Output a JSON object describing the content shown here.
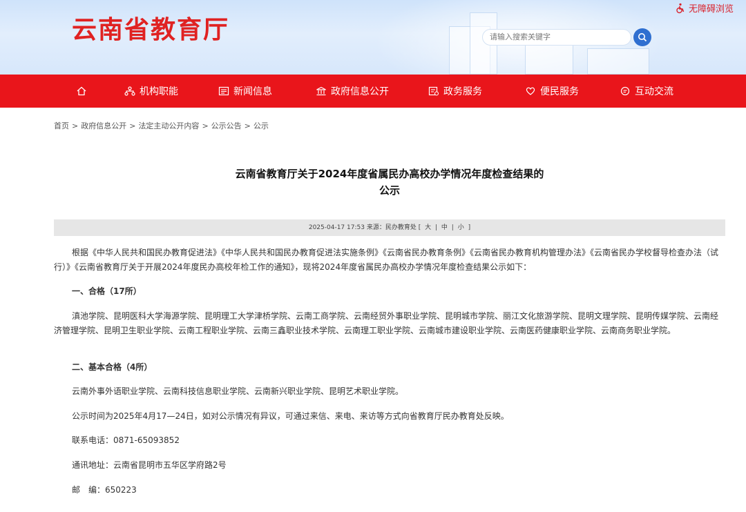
{
  "header": {
    "site_title": "云南省教育厅",
    "accessibility_link": "无障碍浏览",
    "search_placeholder": "请输入搜索关键字"
  },
  "nav": {
    "items": [
      {
        "label": "",
        "icon": "home-icon"
      },
      {
        "label": "机构职能",
        "icon": "org-icon"
      },
      {
        "label": "新闻信息",
        "icon": "news-icon"
      },
      {
        "label": "政府信息公开",
        "icon": "government-icon"
      },
      {
        "label": "政务服务",
        "icon": "service-icon"
      },
      {
        "label": "便民服务",
        "icon": "heart-hand-icon"
      },
      {
        "label": "互动交流",
        "icon": "chat-icon"
      }
    ]
  },
  "breadcrumb": [
    "首页",
    "政府信息公开",
    "法定主动公开内容",
    "公示公告",
    "公示"
  ],
  "article": {
    "title_line1": "云南省教育厅关于2024年度省属民办高校办学情况年度检查结果的",
    "title_line2": "公示",
    "meta": "2025-04-17 17:53 来源：民办教育处",
    "font_sizes": [
      "大",
      "中",
      "小"
    ],
    "paragraphs": {
      "intro": "根据《中华人民共和国民办教育促进法》《中华人民共和国民办教育促进法实施条例》《云南省民办教育条例》《云南省民办教育机构管理办法》《云南省民办学校督导检查办法（试行）》《云南省教育厅关于开展2024年度民办高校年检工作的通知》，现将2024年度省属民办高校办学情况年度检查结果公示如下：",
      "section1_heading": "一、合格（17所）",
      "section1_list": "滇池学院、昆明医科大学海源学院、昆明理工大学津桥学院、云南工商学院、云南经贸外事职业学院、昆明城市学院、丽江文化旅游学院、昆明文理学院、昆明传媒学院、云南经济管理学院、昆明卫生职业学院、云南工程职业学院、云南三鑫职业技术学院、云南理工职业学院、云南城市建设职业学院、云南医药健康职业学院、云南商务职业学院。",
      "section2_heading": "二、基本合格（4所）",
      "section2_list": "云南外事外语职业学院、云南科技信息职业学院、云南新兴职业学院、昆明艺术职业学院。",
      "notice": "公示时间为2025年4月17—24日，如对公示情况有异议，可通过来信、来电、来访等方式向省教育厅民办教育处反映。",
      "phone": "联系电话：0871-65093852",
      "address": "通讯地址：云南省昆明市五华区学府路2号",
      "postcode": "邮　编：650223"
    }
  },
  "colors": {
    "nav_red": "#e9151b",
    "title_red": "#e02222",
    "meta_gray": "#e6e6e6",
    "search_blue": "#2f6fd0"
  }
}
